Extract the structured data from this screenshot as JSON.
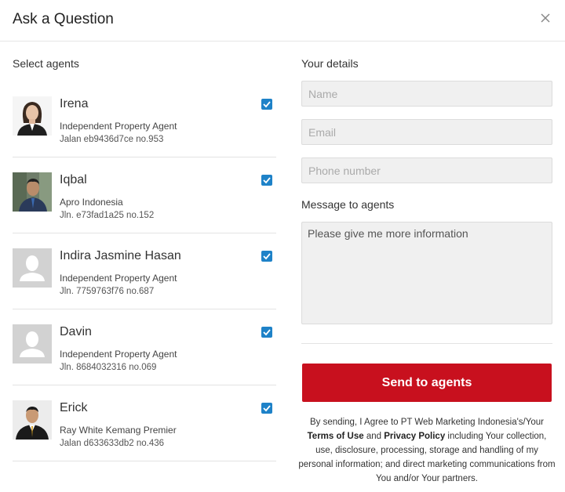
{
  "dialog": {
    "title": "Ask a Question",
    "close_icon": "close-icon"
  },
  "agents_section": {
    "label": "Select agents",
    "agents": [
      {
        "name": "Irena",
        "company": "Independent Property Agent",
        "address": "Jalan eb9436d7ce no.953",
        "checked": true,
        "avatar": "photo-woman"
      },
      {
        "name": "Iqbal",
        "company": "Apro Indonesia",
        "address": "Jln. e73fad1a25 no.152",
        "checked": true,
        "avatar": "photo-man-outdoor"
      },
      {
        "name": "Indira Jasmine Hasan",
        "company": "Independent Property Agent",
        "address": "Jln. 7759763f76 no.687",
        "checked": true,
        "avatar": "default-user-icon"
      },
      {
        "name": "Davin",
        "company": "Independent Property Agent",
        "address": "Jln. 8684032316 no.069",
        "checked": true,
        "avatar": "default-user-icon"
      },
      {
        "name": "Erick",
        "company": "Ray White Kemang Premier",
        "address": "Jalan d633633db2 no.436",
        "checked": true,
        "avatar": "photo-man-suit"
      }
    ]
  },
  "details_section": {
    "label": "Your details",
    "name_placeholder": "Name",
    "email_placeholder": "Email",
    "phone_placeholder": "Phone number"
  },
  "message_section": {
    "label": "Message to agents",
    "value": "Please give me more information"
  },
  "send_button": "Send to agents",
  "legal": {
    "part1": "By sending, I Agree to PT Web Marketing Indonesia's/Your ",
    "terms": "Terms of Use",
    "and": " and ",
    "privacy": "Privacy Policy",
    "part2": " including Your collection, use, disclosure, processing, storage and handling of my personal information; and direct marketing communications from You and/or Your partners."
  },
  "colors": {
    "accent": "#c8101e",
    "checkbox": "#1e82c8"
  }
}
